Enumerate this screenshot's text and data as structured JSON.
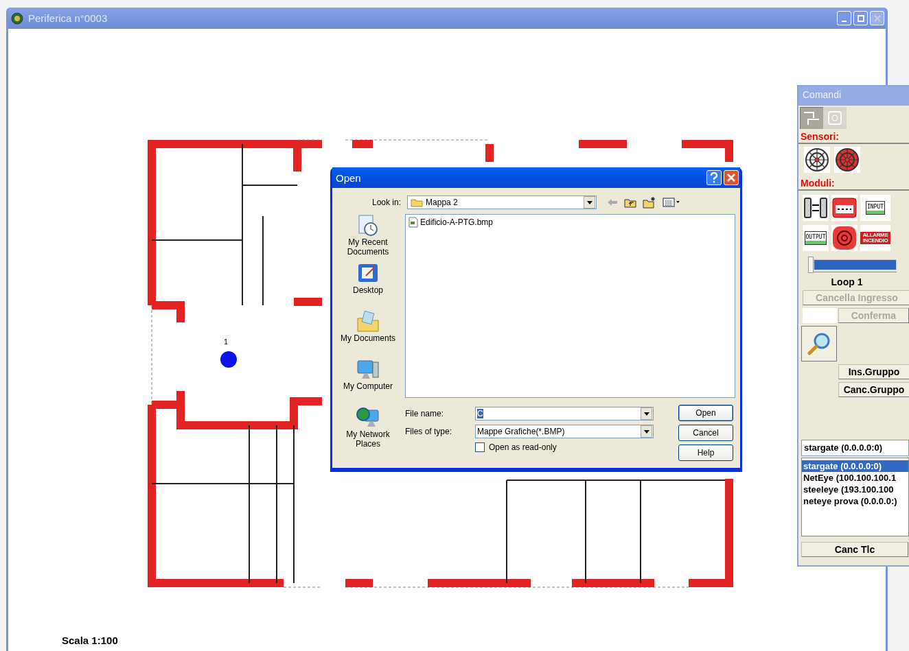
{
  "window": {
    "title": "Periferica n°0003"
  },
  "map": {
    "marker": {
      "label": "1"
    },
    "scale": "Scala 1:100"
  },
  "commands": {
    "title": "Comandi",
    "tabs": [
      {
        "kind": "wiring",
        "selected": true
      },
      {
        "kind": "device",
        "selected": false
      }
    ],
    "sensors_label": "Sensori:",
    "sensors": [
      {
        "kind": "detector"
      },
      {
        "kind": "detector-red"
      }
    ],
    "modules_label": "Moduli:",
    "modules": [
      {
        "kind": "io"
      },
      {
        "kind": "call-point"
      },
      {
        "kind": "label",
        "text": "INPUT"
      },
      {
        "kind": "label",
        "text": "OUTPUT"
      },
      {
        "kind": "siren"
      },
      {
        "kind": "alarm",
        "text": "ALLARME INCENDIO"
      }
    ],
    "loop": {
      "level": 0,
      "label": "Loop 1"
    },
    "clear_input": {
      "label": "Cancella Ingresso",
      "disabled": true
    },
    "confirm": {
      "label": "Conferma",
      "disabled": true
    },
    "group_buttons": [
      {
        "label": "Ins.Gruppo",
        "disabled": false
      },
      {
        "label": "Canc.Gruppo",
        "disabled": false
      }
    ],
    "connection": "stargate (0.0.0.0:0)",
    "connections": [
      {
        "label": "stargate (0.0.0.0:0)",
        "selected": true
      },
      {
        "label": "NetEye (100.100.100.1",
        "selected": false
      },
      {
        "label": "steeleye (193.100.100",
        "selected": false
      },
      {
        "label": "neteye prova (0.0.0.0:)",
        "selected": false
      }
    ],
    "delete_button": "Canc Tlc"
  },
  "open_dialog": {
    "title": "Open",
    "look_in_label": "Look in:",
    "look_in": "Mappa 2",
    "places": [
      {
        "kind": "recent",
        "label": "My Recent Documents"
      },
      {
        "kind": "desktop",
        "label": "Desktop"
      },
      {
        "kind": "documents",
        "label": "My Documents"
      },
      {
        "kind": "computer",
        "label": "My Computer"
      },
      {
        "kind": "network",
        "label": "My Network Places"
      }
    ],
    "files": [
      "Edificio-A-PTG.bmp"
    ],
    "file_name_label": "File name:",
    "file_name": "C",
    "file_type_label": "Files of type:",
    "file_type": "Mappe Grafiche(*.BMP)",
    "read_only": {
      "label": "Open as read-only",
      "checked": false
    },
    "buttons": [
      "Open",
      "Cancel",
      "Help"
    ]
  }
}
